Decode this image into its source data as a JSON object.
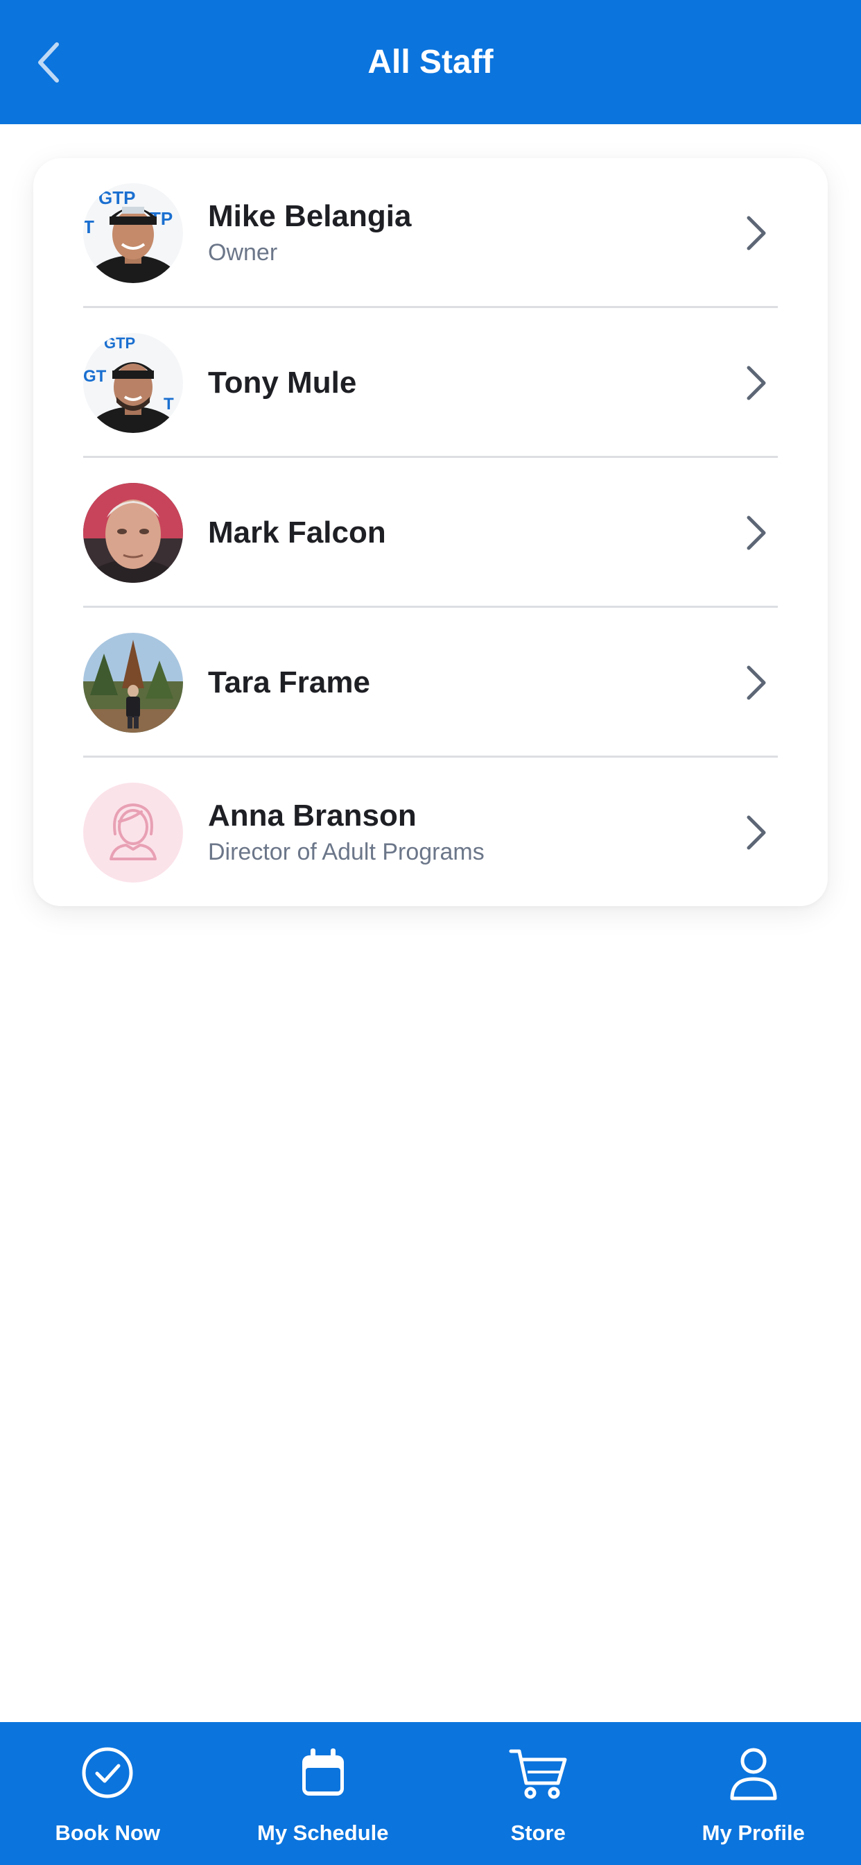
{
  "header": {
    "title": "All Staff",
    "back_icon": "chevron-left-icon"
  },
  "staff": [
    {
      "name": "Mike Belangia",
      "role": "Owner",
      "avatar": "photo"
    },
    {
      "name": "Tony Mule",
      "role": "",
      "avatar": "photo"
    },
    {
      "name": "Mark Falcon",
      "role": "",
      "avatar": "photo"
    },
    {
      "name": "Tara Frame",
      "role": "",
      "avatar": "photo"
    },
    {
      "name": "Anna Branson",
      "role": "Director of Adult Programs",
      "avatar": "placeholder-person-icon"
    }
  ],
  "bottom_nav": [
    {
      "label": "Book Now",
      "icon": "check-circle-icon"
    },
    {
      "label": "My Schedule",
      "icon": "calendar-icon"
    },
    {
      "label": "Store",
      "icon": "cart-icon"
    },
    {
      "label": "My Profile",
      "icon": "user-icon"
    }
  ],
  "colors": {
    "primary": "#0B74DD",
    "text_primary": "#1E1F24",
    "text_secondary": "#6B7689",
    "divider": "#DCDEE2",
    "placeholder_bg": "#FBE3EA",
    "placeholder_icon": "#E8A0B4"
  }
}
